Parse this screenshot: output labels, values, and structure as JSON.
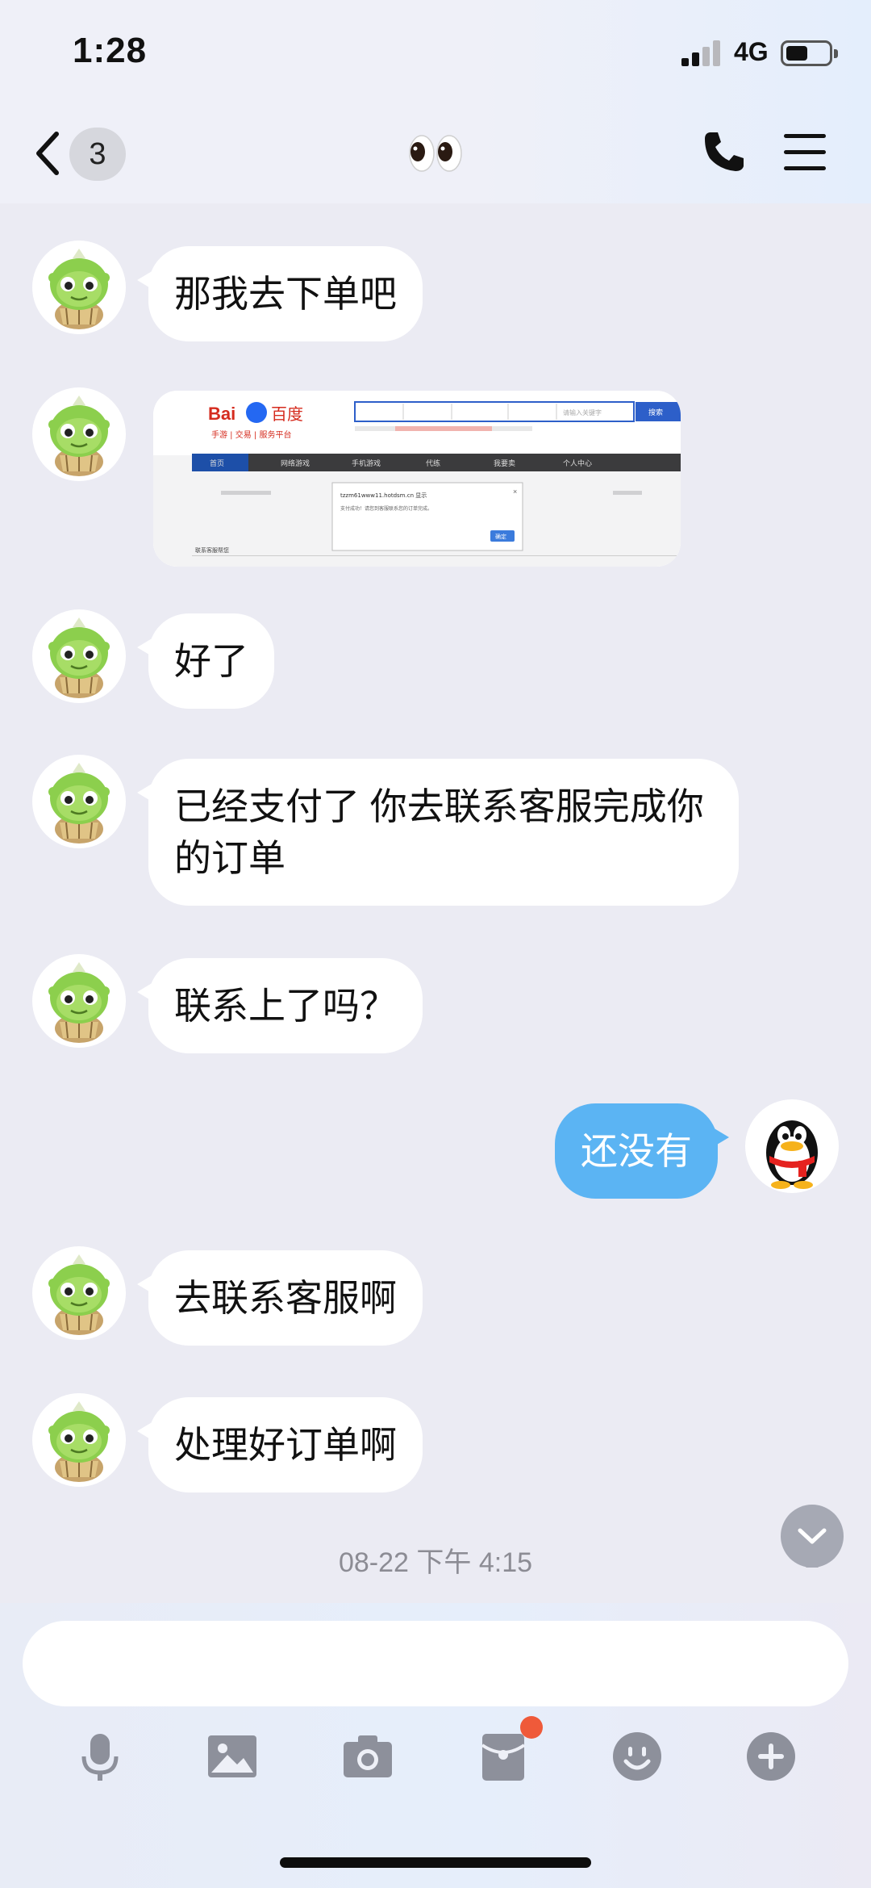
{
  "status_bar": {
    "time": "1:28",
    "network": "4G"
  },
  "header": {
    "unread_count": "3",
    "title_emoji": "👀"
  },
  "messages": [
    {
      "side": "left",
      "type": "text",
      "text": "那我去下单吧"
    },
    {
      "side": "left",
      "type": "image",
      "image": {
        "logo_text": "百度",
        "logo_subtitle": "手游 | 交易 | 服务平台",
        "search_button": "搜索",
        "search_placeholder": "请输入关键字",
        "nav": [
          "首页",
          "网络游戏",
          "手机游戏",
          "代练",
          "我要卖",
          "个人中心"
        ],
        "dialog_title": "tzzm61www11.hotdsm.cn 显示",
        "dialog_text": "支付成功！请您到客服联系您的订单完成。",
        "dialog_button": "确定",
        "footer_text": "联系客服帮您"
      }
    },
    {
      "side": "left",
      "type": "text",
      "text": "好了"
    },
    {
      "side": "left",
      "type": "text",
      "text": "已经支付了  你去联系客服完成你的订单"
    },
    {
      "side": "left",
      "type": "text",
      "text": "联系上了吗？"
    },
    {
      "side": "right",
      "type": "text",
      "text": "还没有"
    },
    {
      "side": "left",
      "type": "text",
      "text": "去联系客服啊"
    },
    {
      "side": "left",
      "type": "text",
      "text": "处理好订单啊"
    }
  ],
  "timestamp": "08-22 下午 4:15",
  "input": {
    "placeholder": ""
  },
  "toolbar": [
    "mic-icon",
    "image-icon",
    "camera-icon",
    "red-packet-icon",
    "emoji-icon",
    "plus-icon"
  ],
  "colors": {
    "sent_bubble": "#5bb4f3",
    "received_bubble": "#ffffff",
    "background": "#ebebf3",
    "notification_dot": "#ef5a3a"
  }
}
